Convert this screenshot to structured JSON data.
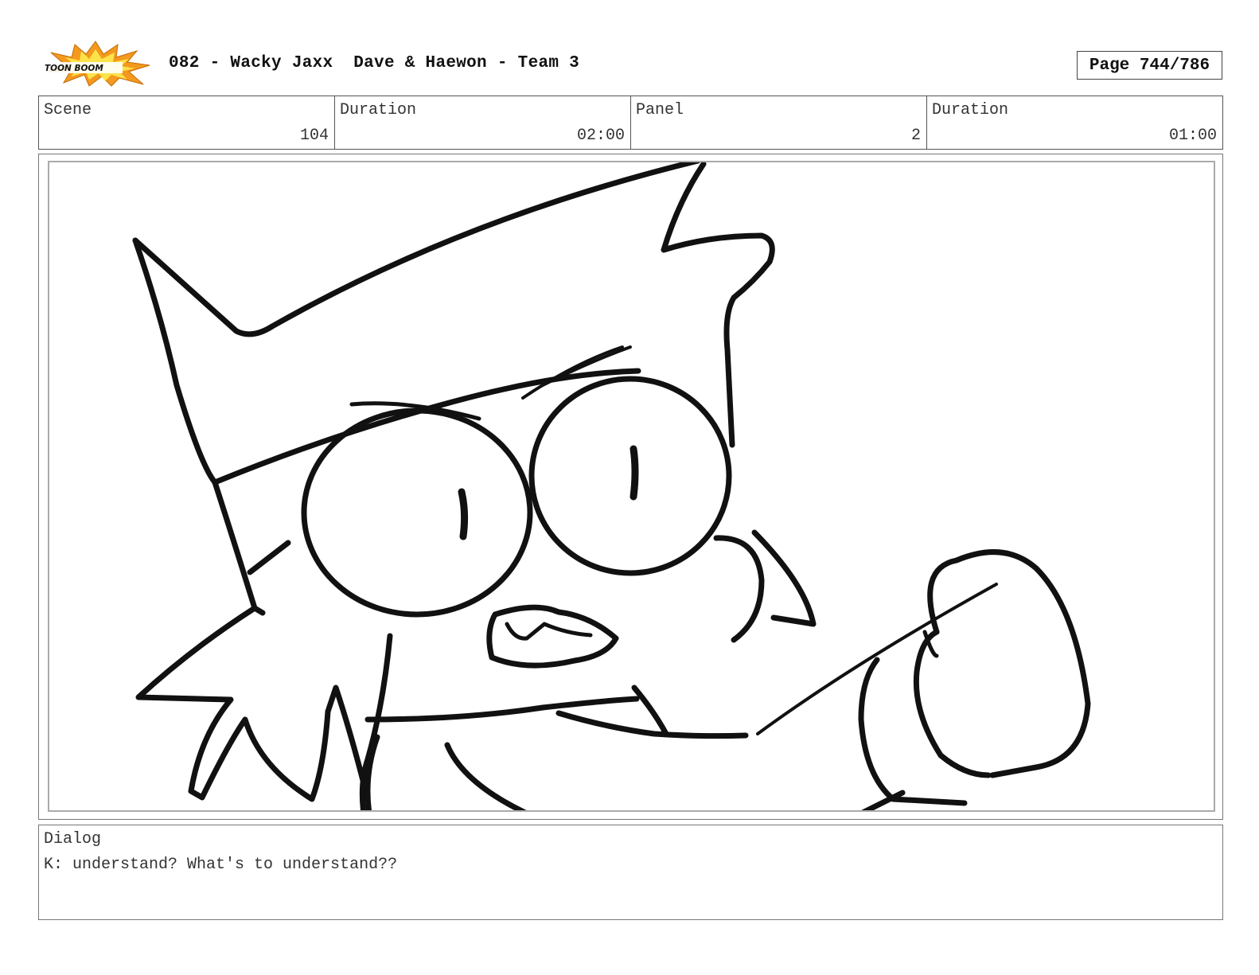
{
  "header": {
    "logo_text": "TOON BOOM",
    "title": "082 - Wacky Jaxx  Dave & Haewon - Team 3",
    "page": "Page 744/786"
  },
  "info": {
    "scene_label": "Scene",
    "scene_value": "104",
    "duration_label": "Duration",
    "duration_value": "02:00",
    "panel_label": "Panel",
    "panel_value": "2",
    "panel_duration_label": "Duration",
    "panel_duration_value": "01:00"
  },
  "dialog": {
    "label": "Dialog",
    "text": "K: understand? What's to understand??"
  },
  "colors": {
    "logo_orange": "#f39a1e",
    "logo_yellow": "#fde34a",
    "ink": "#111111"
  }
}
